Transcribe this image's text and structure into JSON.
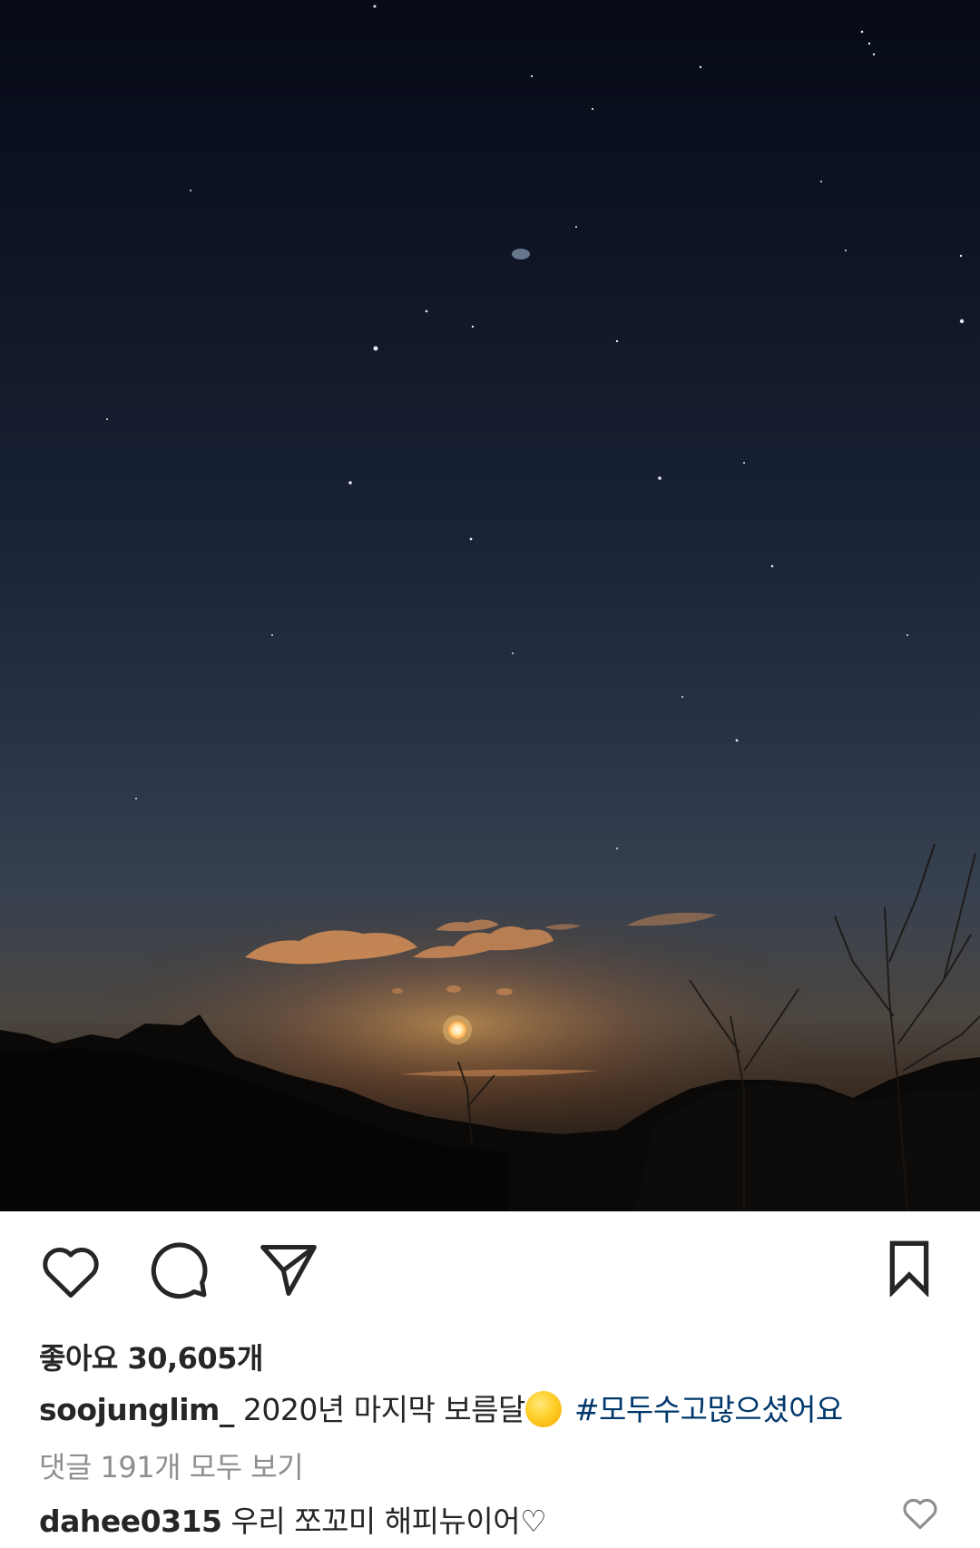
{
  "post": {
    "image_alt": "night sky with full moon over mountains",
    "actions": {
      "like_icon": "heart-outline-icon",
      "comment_icon": "comment-bubble-icon",
      "share_icon": "paper-plane-icon",
      "save_icon": "bookmark-outline-icon"
    },
    "likes_text": "좋아요 30,605개",
    "caption": {
      "username": "soojunglim_",
      "text": "2020년 마지막 보름달",
      "emoji": "full-moon-emoji",
      "hashtag": "#모두수고많으셨어요"
    },
    "view_comments_text": "댓글 191개 모두 보기",
    "top_comment": {
      "username": "dahee0315",
      "text": "우리 쪼꼬미 해피뉴이어♡",
      "like_icon": "small-heart-outline-icon"
    }
  },
  "colors": {
    "text": "#262626",
    "muted": "#8e8e8e",
    "hashtag": "#00376b",
    "moon": "#ffd27a"
  }
}
